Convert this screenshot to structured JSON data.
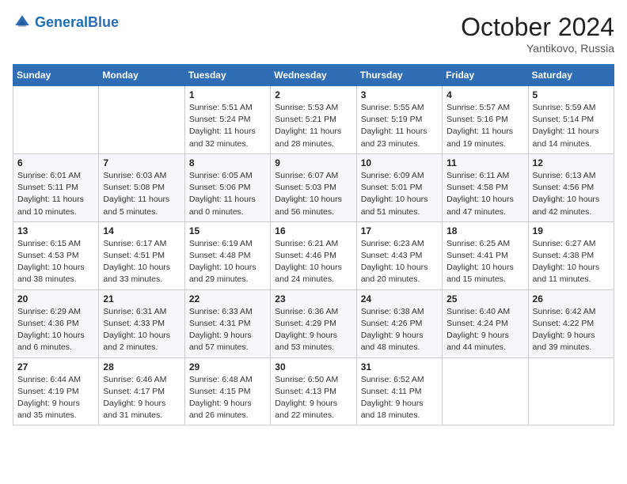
{
  "header": {
    "logo_general": "General",
    "logo_blue": "Blue",
    "month_year": "October 2024",
    "location": "Yantikovo, Russia"
  },
  "days_of_week": [
    "Sunday",
    "Monday",
    "Tuesday",
    "Wednesday",
    "Thursday",
    "Friday",
    "Saturday"
  ],
  "weeks": [
    [
      {
        "day": "",
        "info": ""
      },
      {
        "day": "",
        "info": ""
      },
      {
        "day": "1",
        "info": "Sunrise: 5:51 AM\nSunset: 5:24 PM\nDaylight: 11 hours and 32 minutes."
      },
      {
        "day": "2",
        "info": "Sunrise: 5:53 AM\nSunset: 5:21 PM\nDaylight: 11 hours and 28 minutes."
      },
      {
        "day": "3",
        "info": "Sunrise: 5:55 AM\nSunset: 5:19 PM\nDaylight: 11 hours and 23 minutes."
      },
      {
        "day": "4",
        "info": "Sunrise: 5:57 AM\nSunset: 5:16 PM\nDaylight: 11 hours and 19 minutes."
      },
      {
        "day": "5",
        "info": "Sunrise: 5:59 AM\nSunset: 5:14 PM\nDaylight: 11 hours and 14 minutes."
      }
    ],
    [
      {
        "day": "6",
        "info": "Sunrise: 6:01 AM\nSunset: 5:11 PM\nDaylight: 11 hours and 10 minutes."
      },
      {
        "day": "7",
        "info": "Sunrise: 6:03 AM\nSunset: 5:08 PM\nDaylight: 11 hours and 5 minutes."
      },
      {
        "day": "8",
        "info": "Sunrise: 6:05 AM\nSunset: 5:06 PM\nDaylight: 11 hours and 0 minutes."
      },
      {
        "day": "9",
        "info": "Sunrise: 6:07 AM\nSunset: 5:03 PM\nDaylight: 10 hours and 56 minutes."
      },
      {
        "day": "10",
        "info": "Sunrise: 6:09 AM\nSunset: 5:01 PM\nDaylight: 10 hours and 51 minutes."
      },
      {
        "day": "11",
        "info": "Sunrise: 6:11 AM\nSunset: 4:58 PM\nDaylight: 10 hours and 47 minutes."
      },
      {
        "day": "12",
        "info": "Sunrise: 6:13 AM\nSunset: 4:56 PM\nDaylight: 10 hours and 42 minutes."
      }
    ],
    [
      {
        "day": "13",
        "info": "Sunrise: 6:15 AM\nSunset: 4:53 PM\nDaylight: 10 hours and 38 minutes."
      },
      {
        "day": "14",
        "info": "Sunrise: 6:17 AM\nSunset: 4:51 PM\nDaylight: 10 hours and 33 minutes."
      },
      {
        "day": "15",
        "info": "Sunrise: 6:19 AM\nSunset: 4:48 PM\nDaylight: 10 hours and 29 minutes."
      },
      {
        "day": "16",
        "info": "Sunrise: 6:21 AM\nSunset: 4:46 PM\nDaylight: 10 hours and 24 minutes."
      },
      {
        "day": "17",
        "info": "Sunrise: 6:23 AM\nSunset: 4:43 PM\nDaylight: 10 hours and 20 minutes."
      },
      {
        "day": "18",
        "info": "Sunrise: 6:25 AM\nSunset: 4:41 PM\nDaylight: 10 hours and 15 minutes."
      },
      {
        "day": "19",
        "info": "Sunrise: 6:27 AM\nSunset: 4:38 PM\nDaylight: 10 hours and 11 minutes."
      }
    ],
    [
      {
        "day": "20",
        "info": "Sunrise: 6:29 AM\nSunset: 4:36 PM\nDaylight: 10 hours and 6 minutes."
      },
      {
        "day": "21",
        "info": "Sunrise: 6:31 AM\nSunset: 4:33 PM\nDaylight: 10 hours and 2 minutes."
      },
      {
        "day": "22",
        "info": "Sunrise: 6:33 AM\nSunset: 4:31 PM\nDaylight: 9 hours and 57 minutes."
      },
      {
        "day": "23",
        "info": "Sunrise: 6:36 AM\nSunset: 4:29 PM\nDaylight: 9 hours and 53 minutes."
      },
      {
        "day": "24",
        "info": "Sunrise: 6:38 AM\nSunset: 4:26 PM\nDaylight: 9 hours and 48 minutes."
      },
      {
        "day": "25",
        "info": "Sunrise: 6:40 AM\nSunset: 4:24 PM\nDaylight: 9 hours and 44 minutes."
      },
      {
        "day": "26",
        "info": "Sunrise: 6:42 AM\nSunset: 4:22 PM\nDaylight: 9 hours and 39 minutes."
      }
    ],
    [
      {
        "day": "27",
        "info": "Sunrise: 6:44 AM\nSunset: 4:19 PM\nDaylight: 9 hours and 35 minutes."
      },
      {
        "day": "28",
        "info": "Sunrise: 6:46 AM\nSunset: 4:17 PM\nDaylight: 9 hours and 31 minutes."
      },
      {
        "day": "29",
        "info": "Sunrise: 6:48 AM\nSunset: 4:15 PM\nDaylight: 9 hours and 26 minutes."
      },
      {
        "day": "30",
        "info": "Sunrise: 6:50 AM\nSunset: 4:13 PM\nDaylight: 9 hours and 22 minutes."
      },
      {
        "day": "31",
        "info": "Sunrise: 6:52 AM\nSunset: 4:11 PM\nDaylight: 9 hours and 18 minutes."
      },
      {
        "day": "",
        "info": ""
      },
      {
        "day": "",
        "info": ""
      }
    ]
  ]
}
